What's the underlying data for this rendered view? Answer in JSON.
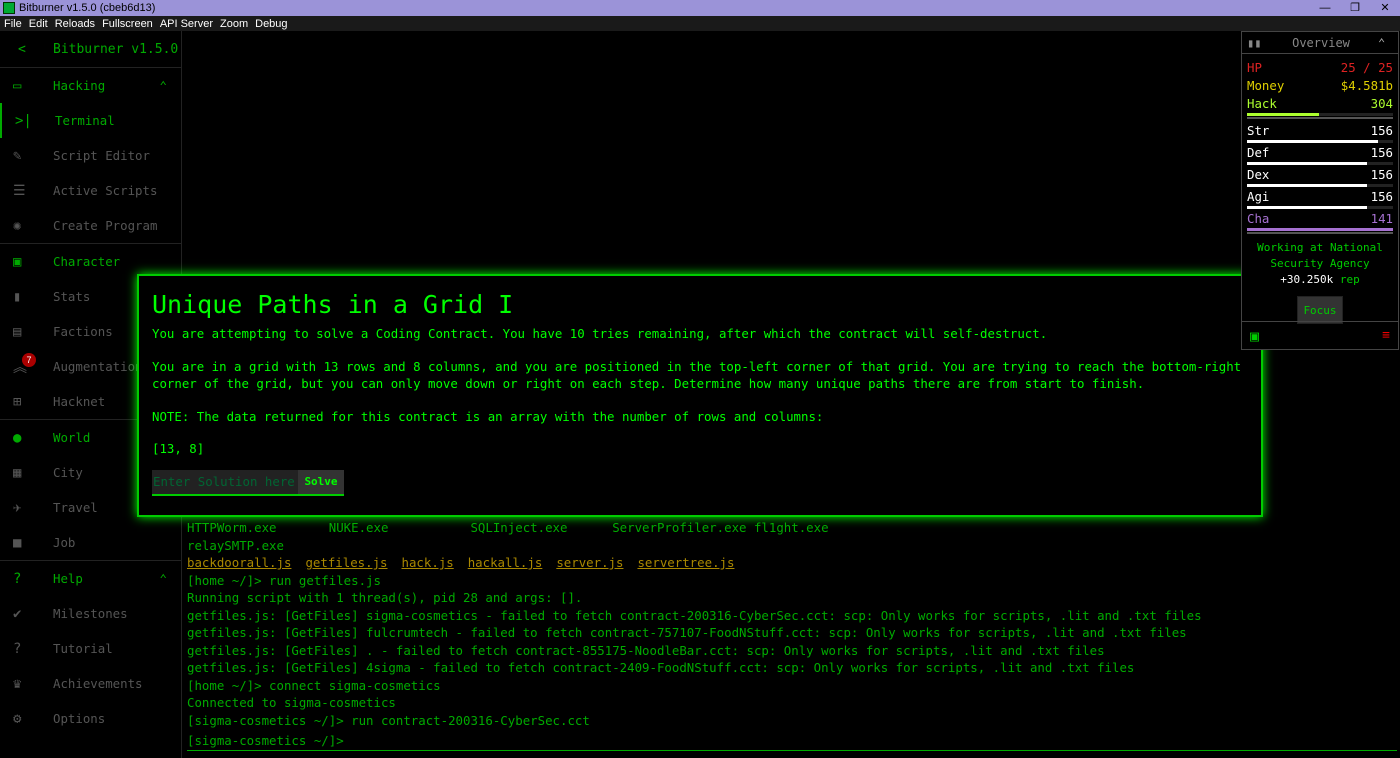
{
  "window": {
    "title": "Bitburner v1.5.0 (cbeb6d13)",
    "controls": [
      "—",
      "❐",
      "✕"
    ]
  },
  "menu": [
    "File",
    "Edit",
    "Reloads",
    "Fullscreen",
    "API Server",
    "Zoom",
    "Debug"
  ],
  "sidebar": {
    "title": "Bitburner v1.5.0",
    "sections": [
      {
        "label": "Hacking",
        "items": [
          "Terminal",
          "Script Editor",
          "Active Scripts",
          "Create Program"
        ]
      },
      {
        "label": "Character",
        "items": [
          "Stats",
          "Factions",
          "Augmentations",
          "Hacknet"
        ]
      },
      {
        "label": "World",
        "items": [
          "City",
          "Travel",
          "Job"
        ]
      },
      {
        "label": "Help",
        "items": [
          "Milestones",
          "Tutorial",
          "Achievements",
          "Options"
        ]
      }
    ],
    "augmentations_badge": "7",
    "active_item": "Terminal"
  },
  "terminal": {
    "lines": [
      "HTTPWorm.exe       NUKE.exe           SQLInject.exe      ServerProfiler.exe fl1ght.exe",
      "relaySMTP.exe"
    ],
    "scripts": [
      "backdoorall.js",
      "getfiles.js",
      "hack.js",
      "hackall.js",
      "server.js",
      "servertree.js"
    ],
    "output": [
      "[home ~/]> run getfiles.js",
      "Running script with 1 thread(s), pid 28 and args: [].",
      "getfiles.js: [GetFiles] sigma-cosmetics - failed to fetch contract-200316-CyberSec.cct: scp: Only works for scripts, .lit and .txt files",
      "getfiles.js: [GetFiles] fulcrumtech - failed to fetch contract-757107-FoodNStuff.cct: scp: Only works for scripts, .lit and .txt files",
      "getfiles.js: [GetFiles] . - failed to fetch contract-855175-NoodleBar.cct: scp: Only works for scripts, .lit and .txt files",
      "getfiles.js: [GetFiles] 4sigma - failed to fetch contract-2409-FoodNStuff.cct: scp: Only works for scripts, .lit and .txt files",
      "[home ~/]> connect sigma-cosmetics",
      "Connected to sigma-cosmetics",
      "[sigma-cosmetics ~/]> run contract-200316-CyberSec.cct"
    ],
    "prompt": "[sigma-cosmetics ~/]>"
  },
  "contract": {
    "title": "Unique Paths in a Grid I",
    "intro": "You are attempting to solve a Coding Contract. You have 10 tries remaining, after which the contract will self-destruct.",
    "description": "You are in a grid with 13 rows and 8 columns, and you are positioned in the top-left corner of that grid. You are trying to reach the bottom-right corner of the grid, but you can only move down or right on each step. Determine how many unique paths there are from start to finish.",
    "note": "NOTE: The data returned for this contract is an array with the number of rows and columns:",
    "data": "[13, 8]",
    "input_placeholder": "Enter Solution here",
    "solve_label": "Solve"
  },
  "overview": {
    "title": "Overview",
    "hp": {
      "label": "HP",
      "value": "25 / 25",
      "color": "#dd2222"
    },
    "money": {
      "label": "Money",
      "value": "$4.581b",
      "color": "#e0d000"
    },
    "stats": [
      {
        "label": "Hack",
        "value": "304",
        "color": "#adff2f",
        "progress": 0.49
      },
      {
        "label": "Str",
        "value": "156",
        "color": "#ffffff",
        "progress": 0.9
      },
      {
        "label": "Def",
        "value": "156",
        "color": "#ffffff",
        "progress": 0.82
      },
      {
        "label": "Dex",
        "value": "156",
        "color": "#ffffff",
        "progress": 0.82
      },
      {
        "label": "Agi",
        "value": "156",
        "color": "#ffffff",
        "progress": 0.82
      },
      {
        "label": "Cha",
        "value": "141",
        "color": "#a671d1",
        "progress": 1.0
      }
    ],
    "work": {
      "prefix": "Working at ",
      "company": "National Security Agency",
      "rep": "+30.250k",
      "rep_label": " rep"
    },
    "focus_label": "Focus"
  }
}
